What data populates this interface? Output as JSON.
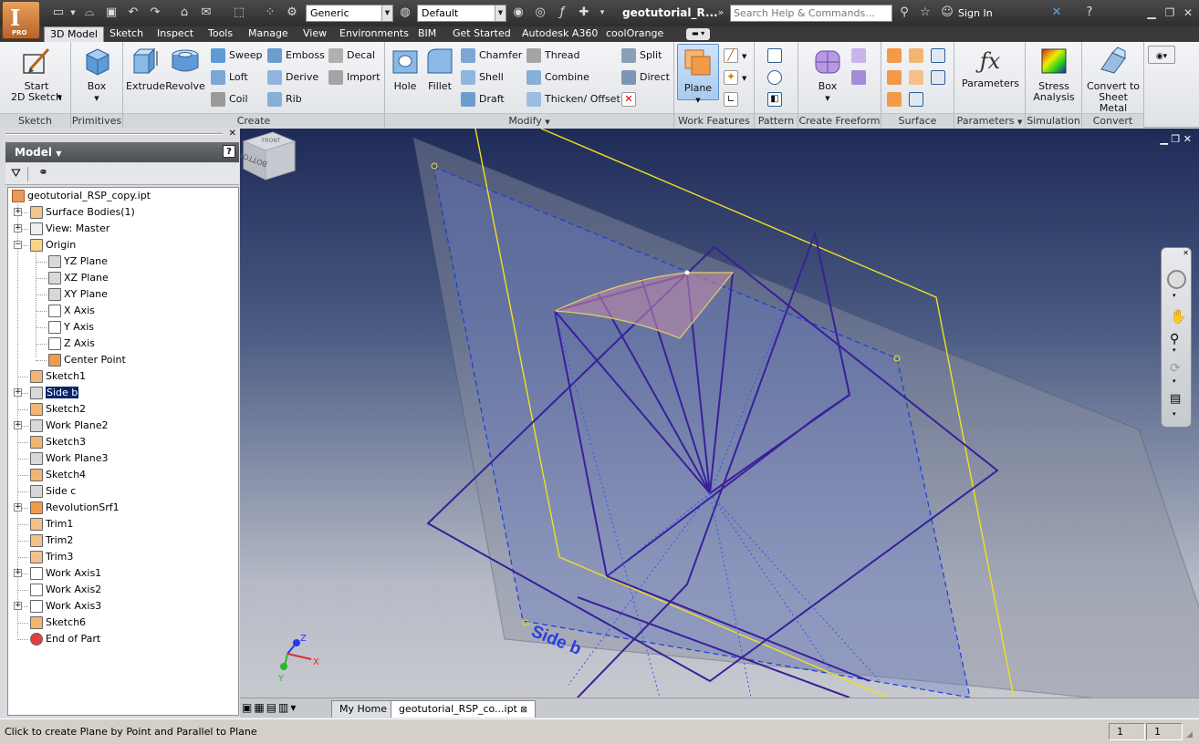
{
  "titlebar": {
    "app_letter": "I",
    "app_edition": "PRO",
    "material_combo": "Generic",
    "appearance_combo": "Default",
    "document_title": "geotutorial_R...",
    "help_search_placeholder": "Search Help & Commands...",
    "sign_in": "Sign In"
  },
  "ribbon_tabs": [
    "3D Model",
    "Sketch",
    "Inspect",
    "Tools",
    "Manage",
    "View",
    "Environments",
    "BIM",
    "Get Started",
    "Autodesk A360",
    "coolOrange"
  ],
  "ribbon": {
    "sketch": {
      "title": "Sketch",
      "start_2d_sketch": "Start\n2D Sketch"
    },
    "primitives": {
      "title": "Primitives",
      "box": "Box"
    },
    "create": {
      "title": "Create",
      "extrude": "Extrude",
      "revolve": "Revolve",
      "sweep": "Sweep",
      "emboss": "Emboss",
      "decal": "Decal",
      "loft": "Loft",
      "derive": "Derive",
      "import": "Import",
      "coil": "Coil",
      "rib": "Rib"
    },
    "modify": {
      "title": "Modify",
      "hole": "Hole",
      "fillet": "Fillet",
      "chamfer": "Chamfer",
      "thread": "Thread",
      "shell": "Shell",
      "combine": "Combine",
      "draft": "Draft",
      "thicken_offset": "Thicken/ Offset",
      "split": "Split",
      "direct": "Direct"
    },
    "work_features": {
      "title": "Work Features",
      "plane": "Plane"
    },
    "pattern": {
      "title": "Pattern"
    },
    "create_freeform": {
      "title": "Create Freeform",
      "box": "Box"
    },
    "surface": {
      "title": "Surface"
    },
    "parameters": {
      "title": "Parameters",
      "parameters": "Parameters"
    },
    "simulation": {
      "title": "Simulation",
      "stress_analysis": "Stress\nAnalysis"
    },
    "convert": {
      "title": "Convert",
      "convert_to_sheet_metal": "Convert to\nSheet Metal"
    }
  },
  "browser": {
    "title": "Model",
    "root": "geotutorial_RSP_copy.ipt",
    "items": [
      {
        "label": "Surface Bodies(1)",
        "level": 0,
        "expander": "+",
        "icon": "surface-bodies-icon"
      },
      {
        "label": "View: Master",
        "level": 0,
        "expander": "+",
        "icon": "view-icon"
      },
      {
        "label": "Origin",
        "level": 0,
        "expander": "-",
        "icon": "folder-icon"
      },
      {
        "label": "YZ Plane",
        "level": 1,
        "expander": "",
        "icon": "plane-icon"
      },
      {
        "label": "XZ Plane",
        "level": 1,
        "expander": "",
        "icon": "plane-icon"
      },
      {
        "label": "XY Plane",
        "level": 1,
        "expander": "",
        "icon": "plane-icon"
      },
      {
        "label": "X Axis",
        "level": 1,
        "expander": "",
        "icon": "axis-icon"
      },
      {
        "label": "Y Axis",
        "level": 1,
        "expander": "",
        "icon": "axis-icon"
      },
      {
        "label": "Z Axis",
        "level": 1,
        "expander": "",
        "icon": "axis-icon"
      },
      {
        "label": "Center Point",
        "level": 1,
        "expander": "",
        "icon": "point-icon"
      },
      {
        "label": "Sketch1",
        "level": 0,
        "expander": "",
        "icon": "sketch-icon"
      },
      {
        "label": "Side b",
        "level": 0,
        "expander": "+",
        "icon": "plane-icon",
        "selected": true
      },
      {
        "label": "Sketch2",
        "level": 0,
        "expander": "",
        "icon": "sketch-icon"
      },
      {
        "label": "Work Plane2",
        "level": 0,
        "expander": "+",
        "icon": "plane-icon"
      },
      {
        "label": "Sketch3",
        "level": 0,
        "expander": "",
        "icon": "sketch-icon"
      },
      {
        "label": "Work Plane3",
        "level": 0,
        "expander": "",
        "icon": "plane-icon"
      },
      {
        "label": "Sketch4",
        "level": 0,
        "expander": "",
        "icon": "sketch-icon"
      },
      {
        "label": "Side c",
        "level": 0,
        "expander": "",
        "icon": "plane-icon"
      },
      {
        "label": "RevolutionSrf1",
        "level": 0,
        "expander": "+",
        "icon": "revolve-icon"
      },
      {
        "label": "Trim1",
        "level": 0,
        "expander": "",
        "icon": "trim-icon"
      },
      {
        "label": "Trim2",
        "level": 0,
        "expander": "",
        "icon": "trim-icon"
      },
      {
        "label": "Trim3",
        "level": 0,
        "expander": "",
        "icon": "trim-icon"
      },
      {
        "label": "Work Axis1",
        "level": 0,
        "expander": "+",
        "icon": "axis-icon"
      },
      {
        "label": "Work Axis2",
        "level": 0,
        "expander": "",
        "icon": "axis-icon"
      },
      {
        "label": "Work Axis3",
        "level": 0,
        "expander": "+",
        "icon": "axis-icon"
      },
      {
        "label": "Sketch6",
        "level": 0,
        "expander": "",
        "icon": "sketch-icon"
      },
      {
        "label": "End of Part",
        "level": 0,
        "expander": "",
        "icon": "end-of-part-icon"
      }
    ]
  },
  "viewport": {
    "plane_label": "Side b",
    "viewcube_top": "FRONT",
    "viewcube_face": "BOTTOM",
    "triad": {
      "x": "X",
      "y": "Y",
      "z": "Z"
    }
  },
  "doc_tabs": {
    "home": "My Home",
    "document": "geotutorial_RSP_co...ipt"
  },
  "statusbar": {
    "message": "Click to create Plane by Point and Parallel to Plane",
    "cell1": "1",
    "cell2": "1"
  },
  "colors": {
    "accent": "#5b8fc9",
    "sketch_line": "#3a1f9a",
    "plane_outline": "#f0e020",
    "viewport_top": "#1e2b57"
  }
}
